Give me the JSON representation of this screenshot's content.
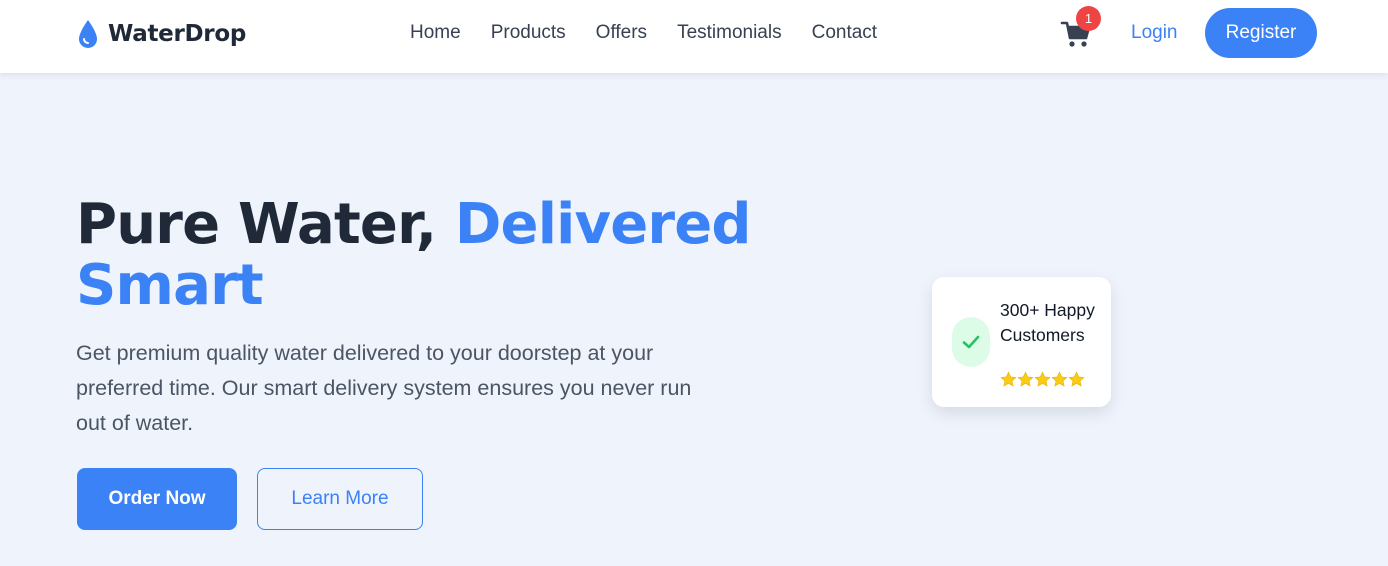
{
  "brand": {
    "name": "WaterDrop",
    "icon": "water-drop-icon"
  },
  "nav": {
    "links": [
      "Home",
      "Products",
      "Offers",
      "Testimonials",
      "Contact"
    ]
  },
  "cart": {
    "icon": "shopping-cart-icon",
    "count": "1"
  },
  "auth": {
    "login_label": "Login",
    "register_label": "Register"
  },
  "hero": {
    "title_part1": "Pure Water, ",
    "title_accent": "Delivered Smart",
    "description": "Get premium quality water delivered to your doorstep at your preferred time. Our smart delivery system ensures you never run out of water.",
    "primary_cta": "Order Now",
    "secondary_cta": "Learn More"
  },
  "stat_card": {
    "icon": "check-icon",
    "text": "300+ Happy Customers",
    "rating": 5
  },
  "colors": {
    "accent": "#3b82f6",
    "background": "#eef3fc",
    "badge": "#ef4444",
    "star": "#facc15",
    "check": "#22c55e"
  }
}
